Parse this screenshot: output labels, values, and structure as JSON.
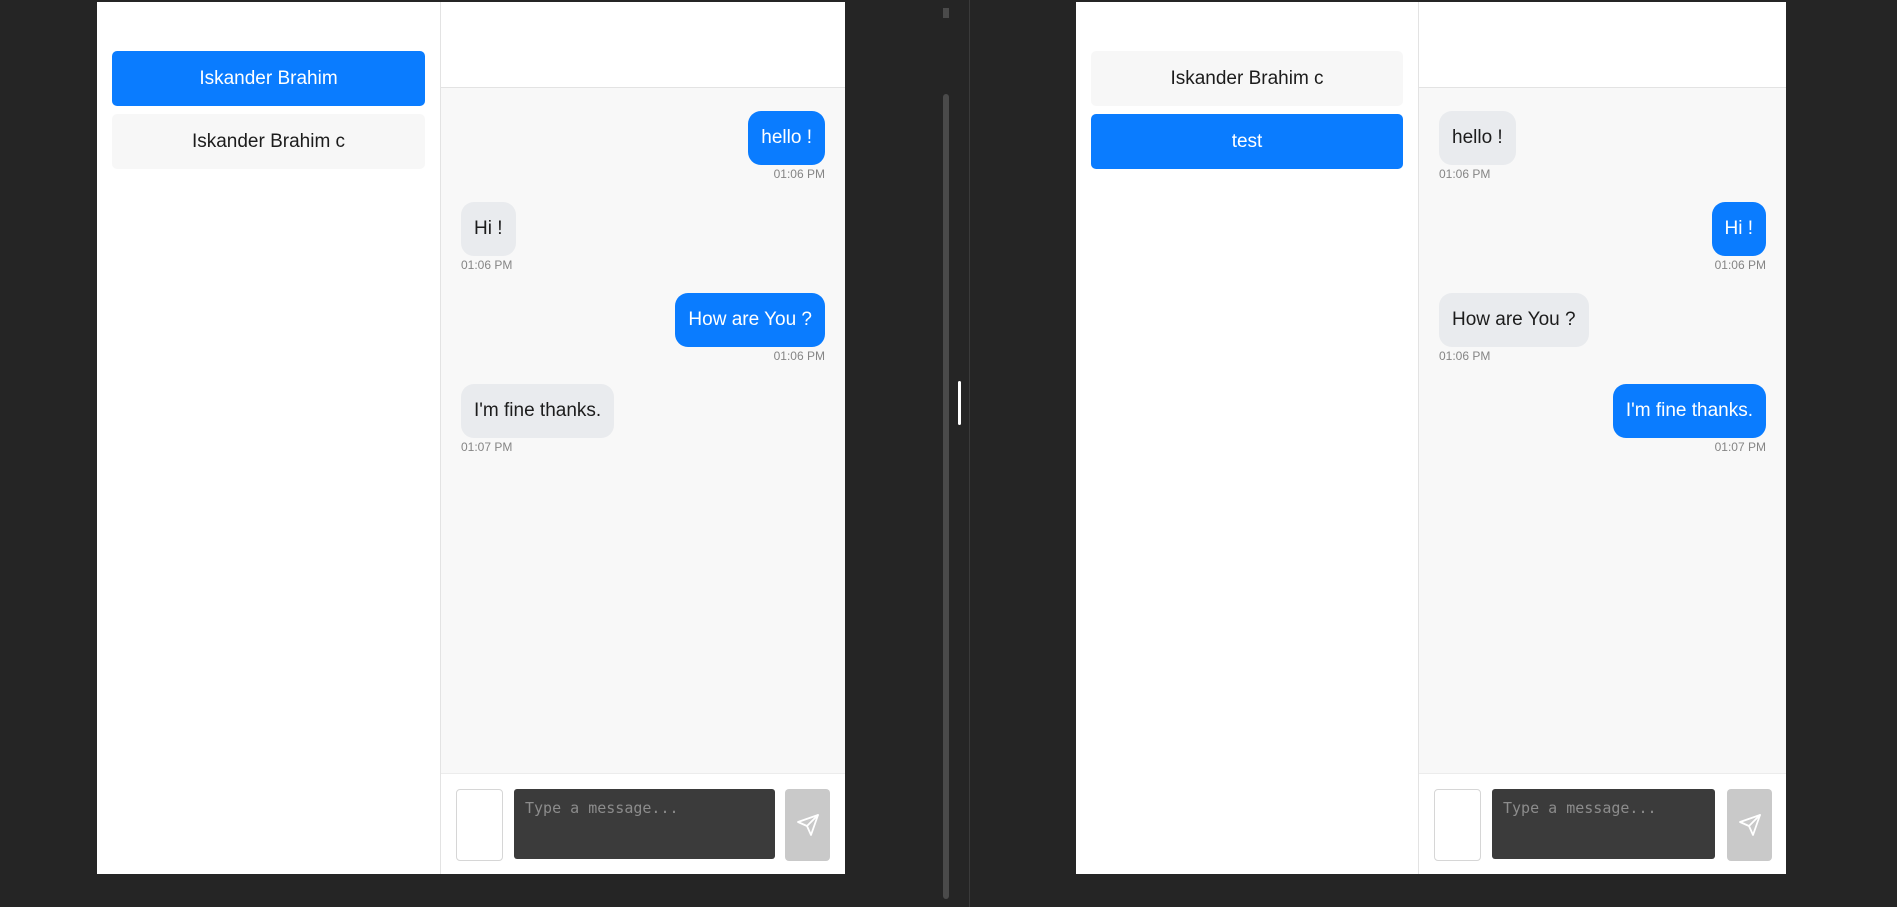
{
  "left_window": {
    "contacts": [
      {
        "name": "Iskander Brahim",
        "active": true
      },
      {
        "name": "Iskander Brahim c",
        "active": false
      }
    ],
    "messages": [
      {
        "text": "hello !",
        "time": "01:06 PM",
        "side": "sent"
      },
      {
        "text": "Hi !",
        "time": "01:06 PM",
        "side": "recv"
      },
      {
        "text": "How are You ?",
        "time": "01:06 PM",
        "side": "sent"
      },
      {
        "text": "I'm fine thanks.",
        "time": "01:07 PM",
        "side": "recv"
      }
    ],
    "composer": {
      "placeholder": "Type a message..."
    }
  },
  "right_window": {
    "contacts": [
      {
        "name": "Iskander Brahim c",
        "active": false
      },
      {
        "name": "test",
        "active": true
      }
    ],
    "messages": [
      {
        "text": "hello !",
        "time": "01:06 PM",
        "side": "recv"
      },
      {
        "text": "Hi !",
        "time": "01:06 PM",
        "side": "sent"
      },
      {
        "text": "How are You ?",
        "time": "01:06 PM",
        "side": "recv"
      },
      {
        "text": "I'm fine thanks.",
        "time": "01:07 PM",
        "side": "sent"
      }
    ],
    "composer": {
      "placeholder": "Type a message..."
    }
  },
  "colors": {
    "accent": "#0a7cff",
    "received_bubble": "#e9ebee",
    "background": "#252525"
  },
  "icons": {
    "send": "paper-plane-icon"
  }
}
